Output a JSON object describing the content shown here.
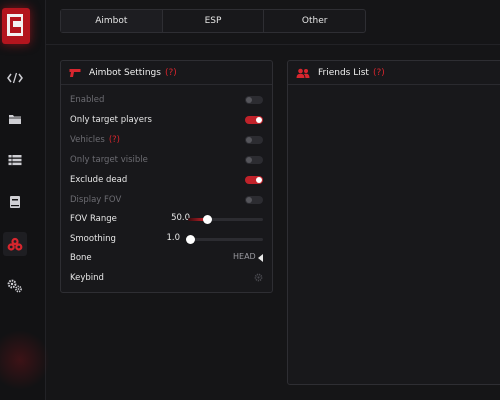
{
  "tabs": [
    {
      "label": "Aimbot",
      "active": true
    },
    {
      "label": "ESP",
      "active": false
    },
    {
      "label": "Other",
      "active": false
    }
  ],
  "sidebar": {
    "items": [
      {
        "icon": "code-icon",
        "active": false
      },
      {
        "icon": "folder-icon",
        "active": false
      },
      {
        "icon": "list-icon",
        "active": false
      },
      {
        "icon": "book-icon",
        "active": false
      },
      {
        "icon": "biohazard-icon",
        "active": true
      },
      {
        "icon": "gears-icon",
        "active": false
      }
    ]
  },
  "aimbot_panel": {
    "title": "Aimbot Settings",
    "help": "(?)",
    "settings": {
      "enabled": {
        "label": "Enabled",
        "on": false,
        "disabled": true
      },
      "only_target_players": {
        "label": "Only target players",
        "on": true,
        "disabled": false
      },
      "vehicles": {
        "label": "Vehicles",
        "help": "(?)",
        "on": false,
        "disabled": true
      },
      "only_target_visible": {
        "label": "Only target visible",
        "on": false,
        "disabled": true
      },
      "exclude_dead": {
        "label": "Exclude dead",
        "on": true,
        "disabled": false
      },
      "display_fov": {
        "label": "Display FOV",
        "on": false,
        "disabled": true
      },
      "fov_range": {
        "label": "FOV Range",
        "value": "50.0",
        "fraction": 0.22
      },
      "smoothing": {
        "label": "Smoothing",
        "value": "1.0",
        "fraction": 0.0
      },
      "bone": {
        "label": "Bone",
        "value": "HEAD"
      },
      "keybind": {
        "label": "Keybind"
      }
    }
  },
  "friends_panel": {
    "title": "Friends List",
    "help": "(?)"
  },
  "colors": {
    "accent": "#c0222a",
    "background": "#151517",
    "panel": "#18181b"
  }
}
